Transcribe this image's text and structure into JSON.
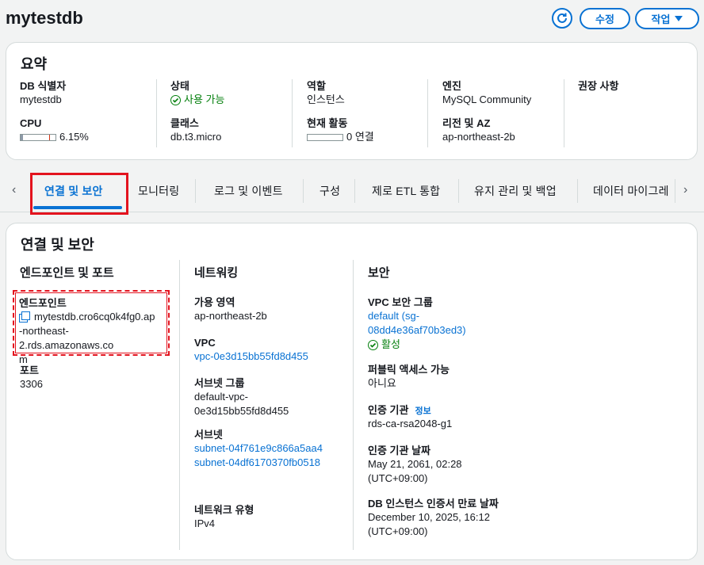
{
  "header": {
    "title": "mytestdb",
    "refresh_icon": "refresh-icon",
    "edit_label": "수정",
    "actions_label": "작업"
  },
  "summary": {
    "title": "요약",
    "db_id": {
      "label": "DB 식별자",
      "value": "mytestdb"
    },
    "cpu": {
      "label": "CPU",
      "value": "6.15%",
      "fraction": 0.0615
    },
    "status": {
      "label": "상태",
      "value": "사용 가능"
    },
    "class": {
      "label": "클래스",
      "value": "db.t3.micro"
    },
    "role": {
      "label": "역할",
      "value": "인스턴스"
    },
    "activity": {
      "label": "현재 활동",
      "value": "0 연결",
      "fraction": 0
    },
    "engine": {
      "label": "엔진",
      "value": "MySQL Community"
    },
    "region": {
      "label": "리전 및 AZ",
      "value": "ap-northeast-2b"
    },
    "recommendation": {
      "label": "권장 사항"
    }
  },
  "tabs": [
    {
      "label": "연결 및 보안",
      "active": true
    },
    {
      "label": "모니터링"
    },
    {
      "label": "로그 및 이벤트"
    },
    {
      "label": "구성"
    },
    {
      "label": "제로 ETL 통합"
    },
    {
      "label": "유지 관리 및 백업"
    },
    {
      "label": "데이터 마이그레"
    }
  ],
  "connectivity": {
    "title": "연결 및 보안",
    "endpoint_section": {
      "title": "엔드포인트 및 포트",
      "endpoint_label": "엔드포인트",
      "endpoint_line1": "mytestdb.cro6cq0k4fg0.ap",
      "endpoint_line2": "-northeast-2.rds.amazonaws.co",
      "endpoint_line3": "m",
      "port_label": "포트",
      "port_value": "3306"
    },
    "networking": {
      "title": "네트워킹",
      "az_label": "가용 영역",
      "az_value": "ap-northeast-2b",
      "vpc_label": "VPC",
      "vpc_value": "vpc-0e3d15bb55fd8d455",
      "subnet_group_label": "서브넷 그룹",
      "subnet_group_line1": "default-vpc-",
      "subnet_group_line2": "0e3d15bb55fd8d455",
      "subnets_label": "서브넷",
      "subnet1": "subnet-04f761e9c866a5aa4",
      "subnet2": "subnet-04df6170370fb0518",
      "network_type_label": "네트워크 유형",
      "network_type_value": "IPv4"
    },
    "security": {
      "title": "보안",
      "vpc_sg_label": "VPC 보안 그룹",
      "vpc_sg_line1": "default (sg-",
      "vpc_sg_line2": "08dd4e36af70b3ed3)",
      "vpc_sg_status": "활성",
      "public_label": "퍼블릭 액세스 가능",
      "public_value": "아니요",
      "ca_label": "인증 기관",
      "ca_info": "정보",
      "ca_value": "rds-ca-rsa2048-g1",
      "ca_date_label": "인증 기관 날짜",
      "ca_date_line1": "May 21, 2061, 02:28",
      "ca_date_line2": "(UTC+09:00)",
      "cert_exp_label": "DB 인스턴스 인증서 만료 날짜",
      "cert_exp_line1": "December 10, 2025, 16:12",
      "cert_exp_line2": "(UTC+09:00)"
    }
  },
  "colors": {
    "accent": "#0972d3",
    "success": "#037f0c",
    "highlight": "#e3131e"
  }
}
